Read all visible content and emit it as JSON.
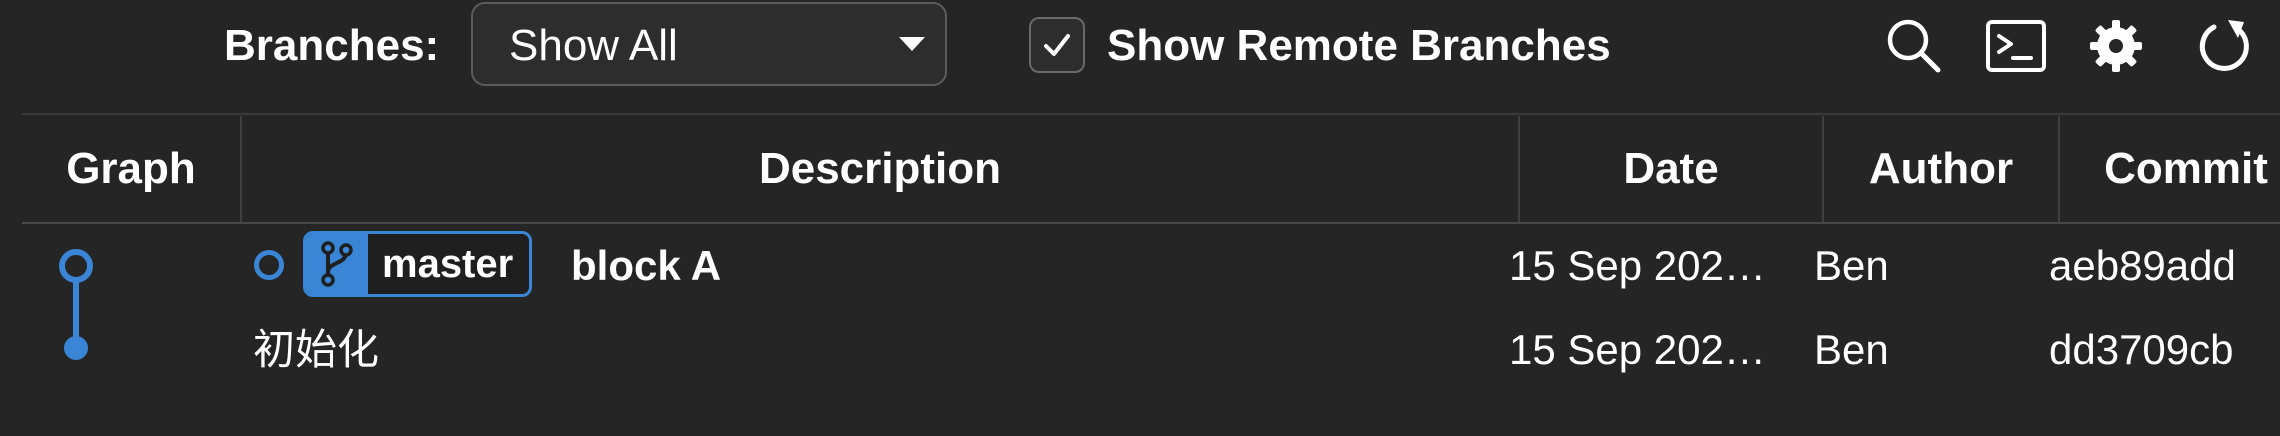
{
  "toolbar": {
    "branches_label": "Branches:",
    "branch_select_value": "Show All",
    "show_remote_label": "Show Remote Branches",
    "show_remote_checked": true
  },
  "table": {
    "columns": [
      "Graph",
      "Description",
      "Date",
      "Author",
      "Commit"
    ],
    "rows": [
      {
        "branch_tag": "master",
        "description": "block A",
        "date": "15 Sep 202…",
        "author": "Ben",
        "commit": "aeb89add"
      },
      {
        "branch_tag": "",
        "description": "初始化",
        "date": "15 Sep 202…",
        "author": "Ben",
        "commit": "dd3709cb"
      }
    ]
  },
  "colors": {
    "accent": "#3a85d6",
    "background": "#252526",
    "text": "#ffffff"
  },
  "icons": [
    "search-icon",
    "terminal-icon",
    "gear-icon",
    "refresh-icon",
    "branch-icon",
    "checkmark-icon"
  ]
}
